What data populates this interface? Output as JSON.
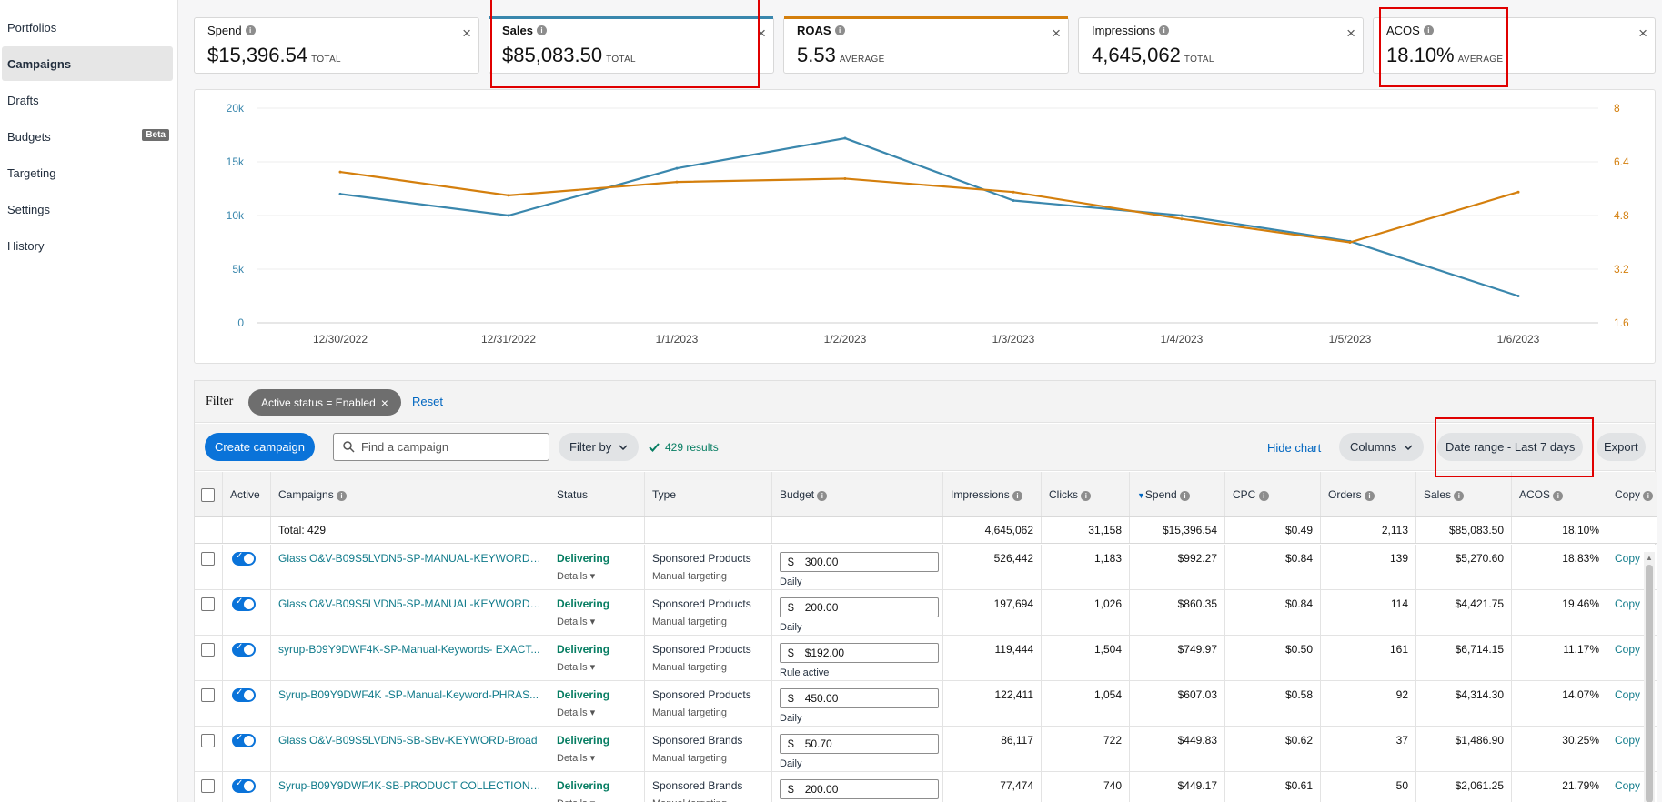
{
  "sidebar": {
    "items": [
      {
        "label": "Portfolios"
      },
      {
        "label": "Campaigns"
      },
      {
        "label": "Drafts"
      },
      {
        "label": "Budgets",
        "badge": "Beta"
      },
      {
        "label": "Targeting"
      },
      {
        "label": "Settings"
      },
      {
        "label": "History"
      }
    ]
  },
  "metrics": [
    {
      "label": "Spend",
      "value": "$15,396.54",
      "sub": "TOTAL",
      "color": ""
    },
    {
      "label": "Sales",
      "value": "$85,083.50",
      "sub": "TOTAL",
      "color": "#3a87ad"
    },
    {
      "label": "ROAS",
      "value": "5.53",
      "sub": "AVERAGE",
      "color": "#d47f0d"
    },
    {
      "label": "Impressions",
      "value": "4,645,062",
      "sub": "TOTAL",
      "color": ""
    },
    {
      "label": "ACOS",
      "value": "18.10%",
      "sub": "AVERAGE",
      "color": ""
    }
  ],
  "close_glyph": "×",
  "chart_data": {
    "type": "line",
    "x": [
      "12/30/2022",
      "12/31/2022",
      "1/1/2023",
      "1/2/2023",
      "1/3/2023",
      "1/4/2023",
      "1/5/2023",
      "1/6/2023"
    ],
    "y_left_ticks": [
      "20k",
      "15k",
      "10k",
      "5k",
      "0"
    ],
    "y_right_ticks": [
      "8",
      "6.4",
      "4.8",
      "3.2",
      "1.6"
    ],
    "ylim_left": [
      0,
      20000
    ],
    "ylim_right": [
      1.6,
      8
    ],
    "grid": true,
    "series": [
      {
        "axis": "left",
        "color": "#3a87ad",
        "values": [
          12000,
          10000,
          14400,
          17200,
          11400,
          10000,
          7600,
          2500
        ]
      },
      {
        "axis": "right",
        "color": "#d47f0d",
        "values": [
          6.1,
          5.4,
          5.8,
          5.9,
          5.5,
          4.7,
          4.0,
          5.5
        ]
      }
    ]
  },
  "filter": {
    "label": "Filter",
    "chip": "Active status = Enabled",
    "chip_close": "×",
    "reset": "Reset"
  },
  "toolbar": {
    "create": "Create campaign",
    "search_placeholder": "Find a campaign",
    "filter_by": "Filter by",
    "results": "429 results",
    "hide_chart": "Hide chart",
    "columns": "Columns",
    "date_range": "Date range - Last 7 days",
    "export": "Export"
  },
  "table": {
    "headers": [
      "Active",
      "Campaigns",
      "Status",
      "Type",
      "Budget",
      "Impressions",
      "Clicks",
      "Spend",
      "CPC",
      "Orders",
      "Sales",
      "ACOS",
      "Copy"
    ],
    "totals": {
      "label": "Total: 429",
      "impressions": "4,645,062",
      "clicks": "31,158",
      "spend": "$15,396.54",
      "cpc": "$0.49",
      "orders": "2,113",
      "sales": "$85,083.50",
      "acos": "18.10%"
    },
    "rows": [
      {
        "campaign": "Glass O&V-B09S5LVDN5-SP-MANUAL-KEYWORD-...",
        "status": "Delivering",
        "details": "Details ▾",
        "type": "Sponsored Products",
        "targeting": "Manual targeting",
        "currency": "$",
        "budget": "300.00",
        "budget_sub": "Daily",
        "impressions": "526,442",
        "clicks": "1,183",
        "spend": "$992.27",
        "cpc": "$0.84",
        "orders": "139",
        "sales": "$5,270.60",
        "acos": "18.83%",
        "copy": "Copy"
      },
      {
        "campaign": "Glass O&V-B09S5LVDN5-SP-MANUAL-KEYWORD ...",
        "status": "Delivering",
        "details": "Details ▾",
        "type": "Sponsored Products",
        "targeting": "Manual targeting",
        "currency": "$",
        "budget": "200.00",
        "budget_sub": "Daily",
        "impressions": "197,694",
        "clicks": "1,026",
        "spend": "$860.35",
        "cpc": "$0.84",
        "orders": "114",
        "sales": "$4,421.75",
        "acos": "19.46%",
        "copy": "Copy"
      },
      {
        "campaign": "syrup-B09Y9DWF4K-SP-Manual-Keywords- EXACT...",
        "status": "Delivering",
        "details": "Details ▾",
        "type": "Sponsored Products",
        "targeting": "Manual targeting",
        "currency": "$",
        "budget": "$192.00",
        "budget_sub": "Rule active",
        "impressions": "119,444",
        "clicks": "1,504",
        "spend": "$749.97",
        "cpc": "$0.50",
        "orders": "161",
        "sales": "$6,714.15",
        "acos": "11.17%",
        "copy": "Copy"
      },
      {
        "campaign": "Syrup-B09Y9DWF4K -SP-Manual-Keyword-PHRAS...",
        "status": "Delivering",
        "details": "Details ▾",
        "type": "Sponsored Products",
        "targeting": "Manual targeting",
        "currency": "$",
        "budget": "450.00",
        "budget_sub": "Daily",
        "impressions": "122,411",
        "clicks": "1,054",
        "spend": "$607.03",
        "cpc": "$0.58",
        "orders": "92",
        "sales": "$4,314.30",
        "acos": "14.07%",
        "copy": "Copy"
      },
      {
        "campaign": "Glass O&V-B09S5LVDN5-SB-SBv-KEYWORD-Broad",
        "status": "Delivering",
        "details": "Details ▾",
        "type": "Sponsored Brands",
        "targeting": "Manual targeting",
        "currency": "$",
        "budget": "50.70",
        "budget_sub": "Daily",
        "impressions": "86,117",
        "clicks": "722",
        "spend": "$449.83",
        "cpc": "$0.62",
        "orders": "37",
        "sales": "$1,486.90",
        "acos": "30.25%",
        "copy": "Copy"
      },
      {
        "campaign": "Syrup-B09Y9DWF4K-SB-PRODUCT COLLECTION-...",
        "status": "Delivering",
        "details": "Details ▾",
        "type": "Sponsored Brands",
        "targeting": "Manual targeting",
        "currency": "$",
        "budget": "200.00",
        "budget_sub": "",
        "impressions": "77,474",
        "clicks": "740",
        "spend": "$449.17",
        "cpc": "$0.61",
        "orders": "50",
        "sales": "$2,061.25",
        "acos": "21.79%",
        "copy": "Copy"
      }
    ]
  }
}
